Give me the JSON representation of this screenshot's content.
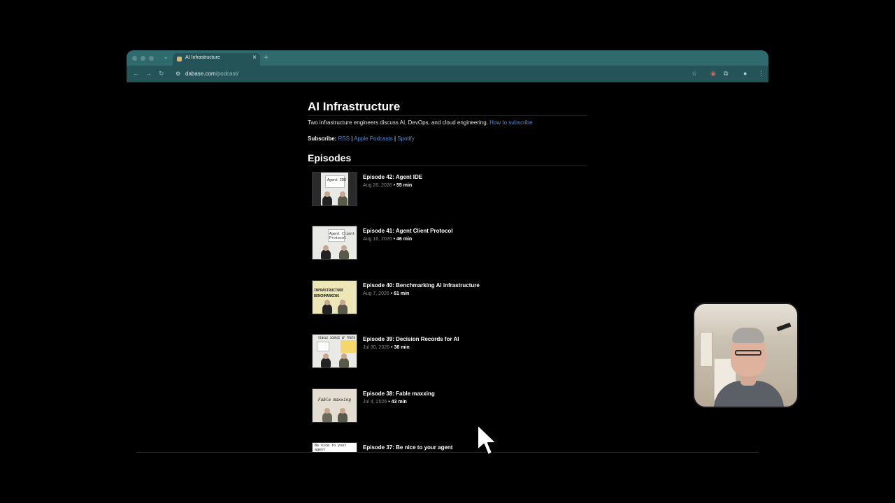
{
  "browser": {
    "tab_title": "AI Infrastructure",
    "tab_close": "×",
    "new_tab": "+",
    "url_host": "dabase.com",
    "url_path": "/podcast/"
  },
  "page": {
    "title": "AI Infrastructure",
    "description": "Two infrastructure engineers discuss AI, DevOps, and cloud engineering.",
    "how_to_subscribe": "How to subscribe",
    "subscribe_label": "Subscribe:",
    "subscribe_links": [
      "RSS",
      "Apple Podcasts",
      "Spotify"
    ],
    "separator": "|",
    "episodes_heading": "Episodes"
  },
  "episodes": [
    {
      "title": "Episode 42: Agent IDE",
      "date": "Aug 26, 2026",
      "duration": "55 min",
      "board": "Agent IDE"
    },
    {
      "title": "Episode 41: Agent Client Protocol",
      "date": "Aug 16, 2026",
      "duration": "46 min",
      "board": "Agent Client Protocol"
    },
    {
      "title": "Episode 40: Benchmarking AI infrastructure",
      "date": "Aug 7, 2026",
      "duration": "61 min",
      "board": "INFRASTRUCTURE BENCHMARKING"
    },
    {
      "title": "Episode 39: Decision Records for AI",
      "date": "Jul 30, 2026",
      "duration": "36 min",
      "board": "SINGLE SOURCE OF TRUTH"
    },
    {
      "title": "Episode 38: Fable maxxing",
      "date": "Jul 4, 2026",
      "duration": "43 min",
      "board": "Fable maxxing"
    },
    {
      "title": "Episode 37: Be nice to your agent",
      "date": "",
      "duration": "",
      "board": "Be nice to your agent"
    }
  ],
  "meta_separator": "•",
  "icons": {
    "back": "back-arrow-icon",
    "forward": "forward-arrow-icon",
    "reload": "reload-icon",
    "bookmark": "star-icon",
    "extensions": "puzzle-icon",
    "menu": "kebab-menu-icon"
  },
  "colors": {
    "tab_bar": "#2f6b6e",
    "toolbar": "#245457",
    "link": "#4f8fd9",
    "page_bg": "#000000"
  }
}
